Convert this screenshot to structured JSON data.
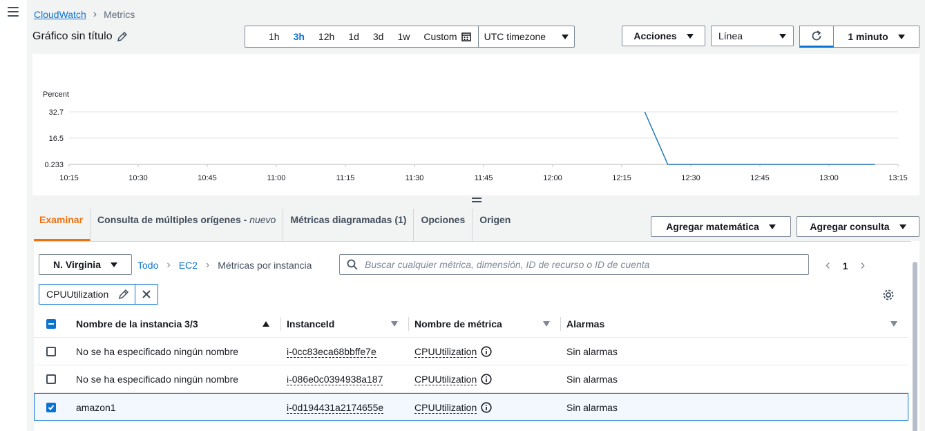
{
  "breadcrumb": {
    "root": "CloudWatch",
    "current": "Metrics"
  },
  "graph": {
    "title": "Gráfico sin título"
  },
  "time_ranges": [
    "1h",
    "3h",
    "12h",
    "1d",
    "3d",
    "1w"
  ],
  "time_range_active": "3h",
  "custom_label": "Custom",
  "timezone": "UTC timezone",
  "actions_label": "Acciones",
  "chart_type": "Línea",
  "refresh_interval": "1 minuto",
  "chart_data": {
    "type": "line",
    "ylabel": "Percent",
    "y_ticks": [
      "32.7",
      "16.5",
      "0.233"
    ],
    "ylim": [
      0.233,
      32.7
    ],
    "x_ticks": [
      "10:15",
      "10:30",
      "10:45",
      "11:00",
      "11:15",
      "11:30",
      "11:45",
      "12:00",
      "12:15",
      "12:30",
      "12:45",
      "13:00",
      "13:15"
    ],
    "series": [
      {
        "color": "#1f77b4",
        "x": [
          "12:20",
          "12:25",
          "12:30",
          "12:35",
          "12:40",
          "12:45",
          "12:50",
          "12:55",
          "13:00",
          "13:05",
          "13:10"
        ],
        "values": [
          32.7,
          0.233,
          0.233,
          0.233,
          0.233,
          0.233,
          0.233,
          0.233,
          0.233,
          0.233,
          0.233
        ]
      }
    ]
  },
  "tabs": {
    "examinar": "Examinar",
    "consulta": "Consulta de múltiples orígenes - ",
    "consulta_new": "nuevo",
    "metricas": "Métricas diagramadas (1)",
    "opciones": "Opciones",
    "origen": "Origen"
  },
  "buttons": {
    "agregar_matematica": "Agregar matemática",
    "agregar_consulta": "Agregar consulta"
  },
  "browse": {
    "region": "N. Virginia",
    "crumbs": [
      "Todo",
      "EC2",
      "Métricas por instancia"
    ],
    "search_placeholder": "Buscar cualquier métrica, dimensión, ID de recurso o ID de cuenta",
    "page": "1",
    "filter_chip": "CPUUtilization"
  },
  "table": {
    "headers": {
      "name": "Nombre de la instancia 3/3",
      "instance": "InstanceId",
      "metric": "Nombre de métrica",
      "alarms": "Alarmas"
    },
    "rows": [
      {
        "name": "No se ha especificado ningún nombre",
        "instance": "i-0cc83eca68bbffe7e",
        "metric": "CPUUtilization",
        "alarms": "Sin alarmas",
        "checked": false
      },
      {
        "name": "No se ha especificado ningún nombre",
        "instance": "i-086e0c0394938a187",
        "metric": "CPUUtilization",
        "alarms": "Sin alarmas",
        "checked": false
      },
      {
        "name": "amazon1",
        "instance": "i-0d194431a2174655e",
        "metric": "CPUUtilization",
        "alarms": "Sin alarmas",
        "checked": true
      }
    ]
  },
  "colors": {
    "accent": "#0972d3",
    "active_tab": "#ec7211",
    "line": "#1f77b4"
  }
}
